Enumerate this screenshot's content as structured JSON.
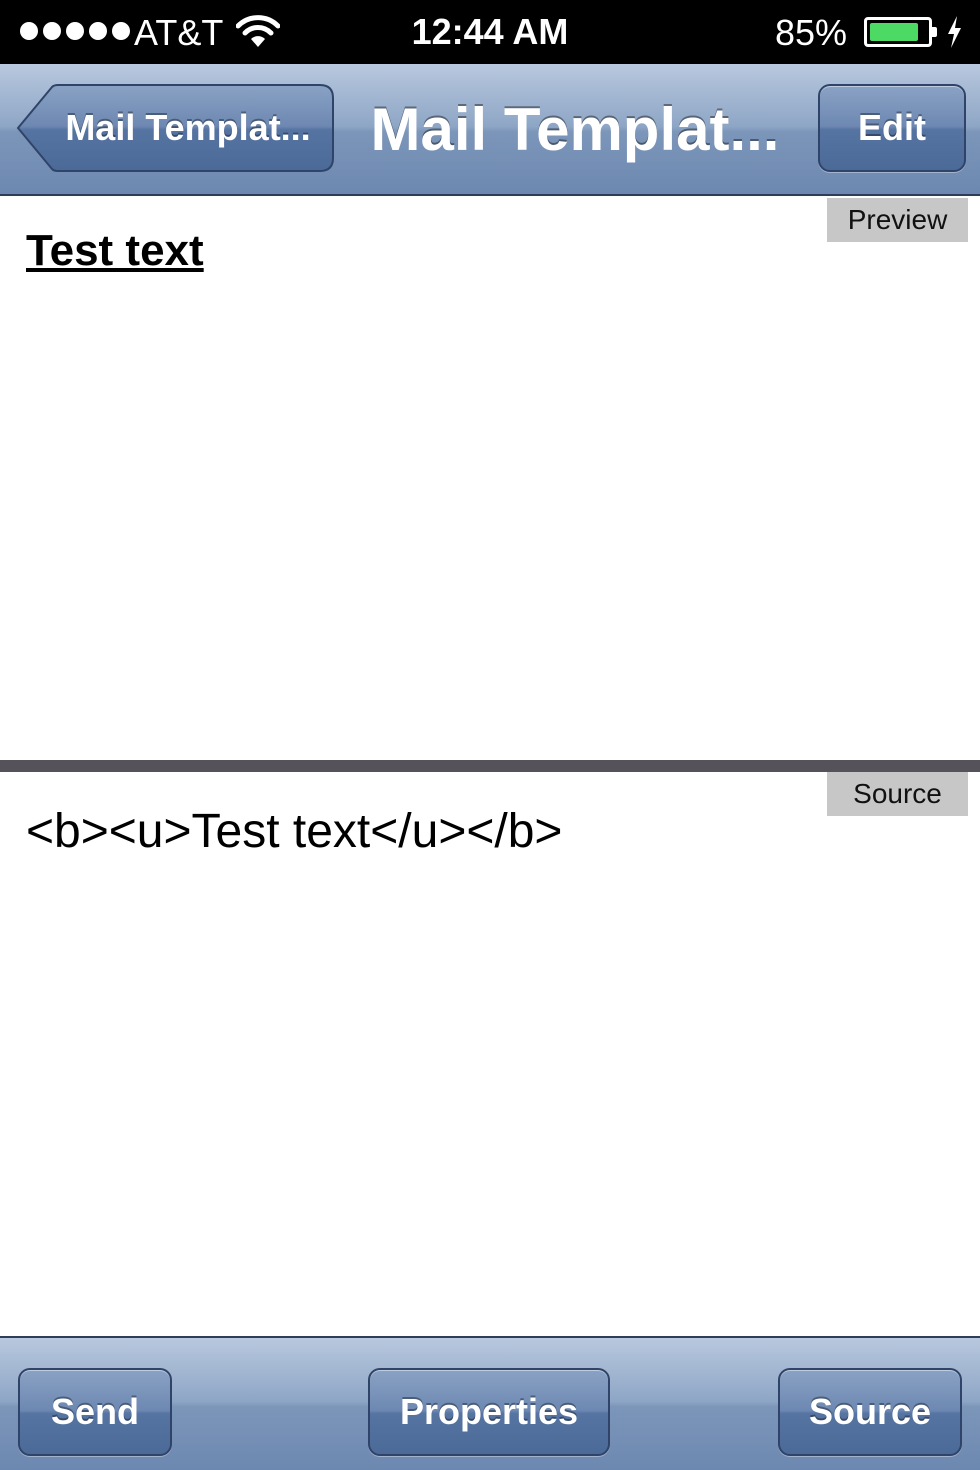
{
  "status_bar": {
    "carrier": "AT&T",
    "time": "12:44 AM",
    "battery_percent": "85%",
    "battery_level": 0.85,
    "signal_bars": 5,
    "battery_color": "#4cd964"
  },
  "nav_bar": {
    "back_label": "Mail Templat...",
    "title": "Mail Templat...",
    "edit_label": "Edit"
  },
  "preview": {
    "tag": "Preview",
    "text": "Test text"
  },
  "source": {
    "tag": "Source",
    "text": "<b><u>Test text</u></b>"
  },
  "toolbar": {
    "send_label": "Send",
    "properties_label": "Properties",
    "source_label": "Source"
  },
  "colors": {
    "bar_accent": "#7c96ba",
    "divider": "#555259"
  }
}
